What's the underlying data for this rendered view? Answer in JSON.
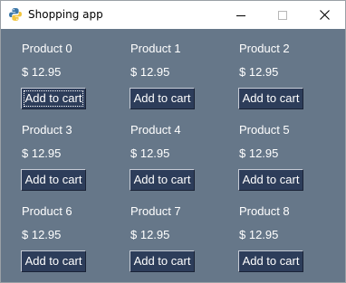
{
  "window": {
    "title": "Shopping app"
  },
  "products": [
    {
      "name": "Product 0",
      "price": "$ 12.95",
      "button_label": "Add to cart"
    },
    {
      "name": "Product 1",
      "price": "$ 12.95",
      "button_label": "Add to cart"
    },
    {
      "name": "Product 2",
      "price": "$ 12.95",
      "button_label": "Add to cart"
    },
    {
      "name": "Product 3",
      "price": "$ 12.95",
      "button_label": "Add to cart"
    },
    {
      "name": "Product 4",
      "price": "$ 12.95",
      "button_label": "Add to cart"
    },
    {
      "name": "Product 5",
      "price": "$ 12.95",
      "button_label": "Add to cart"
    },
    {
      "name": "Product 6",
      "price": "$ 12.95",
      "button_label": "Add to cart"
    },
    {
      "name": "Product 7",
      "price": "$ 12.95",
      "button_label": "Add to cart"
    },
    {
      "name": "Product 8",
      "price": "$ 12.95",
      "button_label": "Add to cart"
    }
  ],
  "colors": {
    "background": "#667789",
    "button": "#2d3d5a",
    "text": "#ffffff"
  },
  "icons": {
    "app": "python-icon",
    "minimize": "minimize-icon",
    "maximize": "maximize-icon",
    "close": "close-icon"
  }
}
